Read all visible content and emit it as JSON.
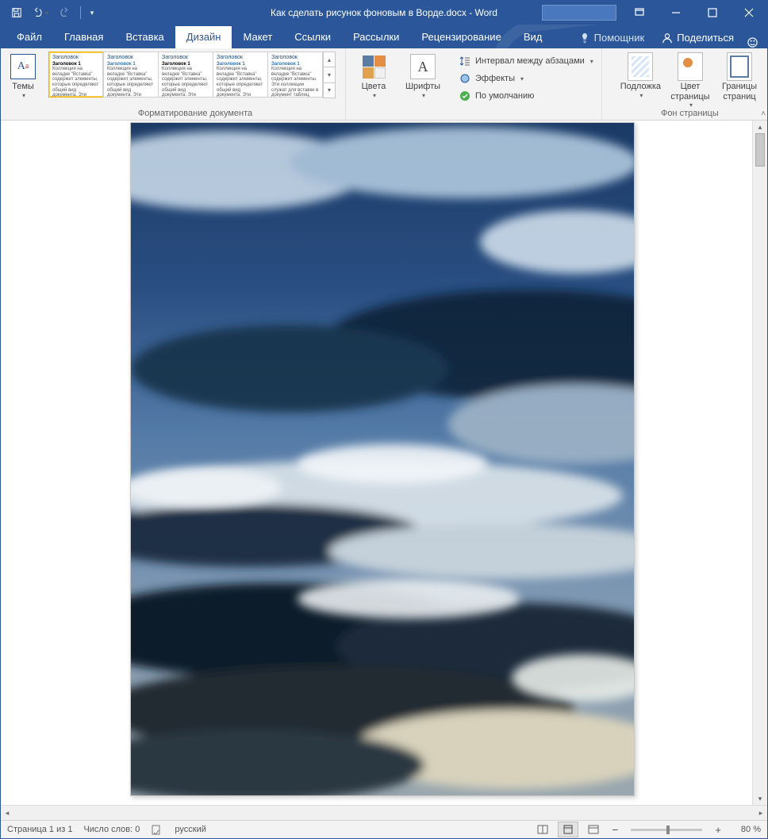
{
  "title": "Как сделать рисунок фоновым в Ворде.docx  -  Word",
  "qat": {
    "save": "save",
    "undo": "undo",
    "redo": "redo"
  },
  "tabs": [
    "Файл",
    "Главная",
    "Вставка",
    "Дизайн",
    "Макет",
    "Ссылки",
    "Рассылки",
    "Рецензирование",
    "Вид"
  ],
  "active_tab": 3,
  "tellme": "Помощник",
  "share": "Поделиться",
  "ribbon": {
    "themes": {
      "label": "Темы"
    },
    "docfmt": {
      "label": "Форматирование документа",
      "items": [
        {
          "h": "Заголовок",
          "sub": "Заголовок 1",
          "body": "Коллекция на вкладке \"Вставка\" содержит элементы, которые определяют общий вид документа. Эти коллекции служат для вставки в документ"
        },
        {
          "h": "Заголовок",
          "sub": "Заголовок 1",
          "body": "Коллекция на вкладке \"Вставка\" содержит элементы, которые определяют общий вид документа. Эти коллекции служат для вставки в документ таблиц, колонтитулов."
        },
        {
          "h": "Заголовок",
          "sub": "Заголовок 1",
          "body": "Коллекция на вкладке \"Вставка\" содержит элементы, которые определяют общий вид документа. Эти коллекции служат для вставки в документ таблиц, колонтитулов."
        },
        {
          "h": "Заголовок",
          "sub": "Заголовок 1",
          "body": "Коллекция на вкладке \"Вставка\" содержит элементы, которые определяют общий вид документа. Эти коллекции служат для оформления документов."
        },
        {
          "h": "Заголовок",
          "sub": "Заголовок 1",
          "body": "Коллекция на вкладке \"Вставка\" содержит элементы. Эти коллекции служат для вставки в документ таблиц, титулов и других"
        }
      ]
    },
    "colors": "Цвета",
    "fonts": "Шрифты",
    "spacing": "Интервал между абзацами",
    "effects": "Эффекты",
    "default": "По умолчанию",
    "pagebg": {
      "label": "Фон страницы",
      "watermark": "Подложка",
      "pagecolor": "Цвет\nстраницы",
      "borders": "Границы\nстраниц"
    }
  },
  "status": {
    "page": "Страница 1 из 1",
    "words": "Число слов: 0",
    "lang": "русский",
    "zoom": "80 %"
  }
}
